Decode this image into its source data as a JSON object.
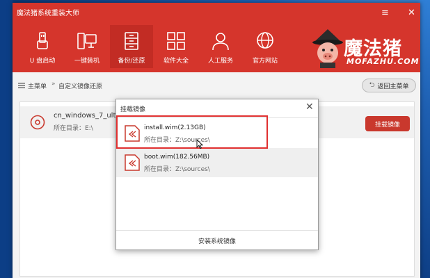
{
  "window": {
    "title": "魔法猪系统重装大师",
    "min_glyph": "≡",
    "close_glyph": "✕"
  },
  "nav": [
    {
      "label": "U 盘启动",
      "icon": "usb-icon"
    },
    {
      "label": "一键装机",
      "icon": "computer-icon"
    },
    {
      "label": "备份/还原",
      "icon": "backup-icon",
      "active": true
    },
    {
      "label": "软件大全",
      "icon": "apps-grid-icon"
    },
    {
      "label": "人工服务",
      "icon": "support-person-icon"
    },
    {
      "label": "官方网站",
      "icon": "globe-icon"
    }
  ],
  "brand": {
    "name": "魔法猪",
    "site": "MOFAZHU.COM"
  },
  "breadcrumb": {
    "home": "主菜单",
    "separator": "»",
    "current": "自定义镜像还原",
    "back_label": "返回主菜单"
  },
  "iso": {
    "name": "cn_windows_7_ultimate_",
    "path": "所在目录：E:\\",
    "mount_label": "挂载镜像"
  },
  "dialog": {
    "title": "挂载镜像",
    "close_glyph": "✕",
    "files": [
      {
        "name": "install.wim(2.13GB)",
        "path": "所在目录：Z:\\sources\\"
      },
      {
        "name": "boot.wim(182.56MB)",
        "path": "所在目录：Z:\\sources\\"
      }
    ],
    "install_label": "安装系统镜像"
  },
  "colors": {
    "header": "#d5352c",
    "active_nav": "#c22c24",
    "button": "#c9382d",
    "highlight": "#e03030"
  }
}
